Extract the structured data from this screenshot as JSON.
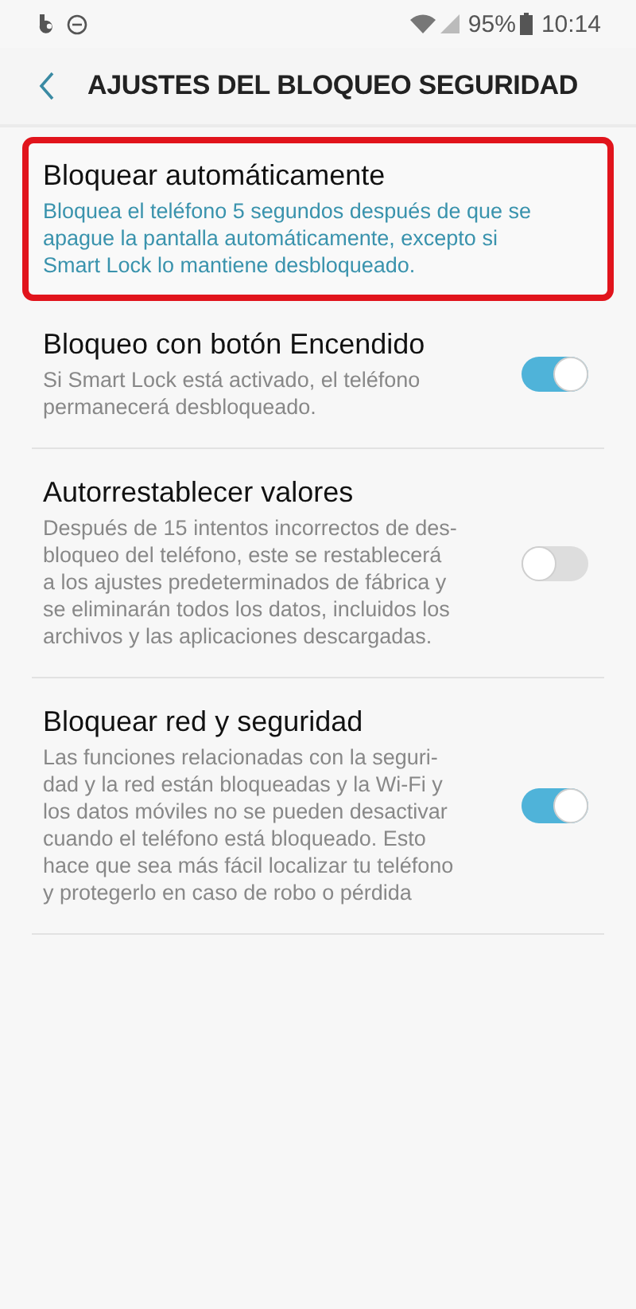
{
  "status_bar": {
    "battery": "95%",
    "time": "10:14"
  },
  "header": {
    "title": "AJUSTES DEL BLOQUEO SEGURIDAD"
  },
  "settings": [
    {
      "kind": "value",
      "title": "Bloquear automáticamente",
      "highlighted": true,
      "description": [
        "Bloquea el teléfono 5 segundos después de que se",
        "apague la pantalla automáticamente, excepto si",
        "Smart Lock lo mantiene desbloqueado."
      ]
    },
    {
      "kind": "toggle",
      "title": "Bloqueo con botón Encendido",
      "on": true,
      "description": [
        "Si Smart Lock está activado, el teléfono",
        "permanecerá desbloqueado."
      ]
    },
    {
      "kind": "toggle",
      "title": "Autorrestablecer valores",
      "on": false,
      "description": [
        "Después de 15 intentos incorrectos de des-",
        "bloqueo del teléfono, este se restablecerá",
        "a los ajustes predeterminados de fábrica y",
        "se eliminarán todos los datos, incluidos los",
        "archivos y las aplicaciones descargadas."
      ]
    },
    {
      "kind": "toggle",
      "title": "Bloquear red y seguridad",
      "on": true,
      "description": [
        "Las funciones relacionadas con la seguri-",
        "dad y la red están bloqueadas y la Wi-Fi y",
        "los datos móviles no se pueden desactivar",
        "cuando el teléfono está bloqueado. Esto",
        "hace que sea más fácil localizar tu teléfono",
        "y protegerlo en caso de robo o pérdida"
      ]
    }
  ]
}
